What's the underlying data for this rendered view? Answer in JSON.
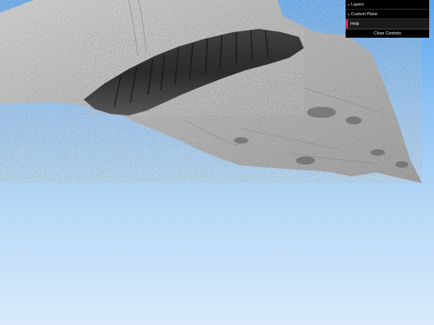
{
  "viewer": {
    "sky_top": "#59a4ef",
    "sky_bottom": "#d9ebfb",
    "terrain_light": "#d4d4d4",
    "terrain_dark": "#1e1e1e"
  },
  "gui": {
    "folders": [
      {
        "label": "Layers",
        "icon": "caret-right-icon"
      },
      {
        "label": "Custom Plane",
        "icon": "caret-right-icon"
      }
    ],
    "help_label": "Help",
    "help_accent": "#e61d5f",
    "close_label": "Close Controls"
  }
}
